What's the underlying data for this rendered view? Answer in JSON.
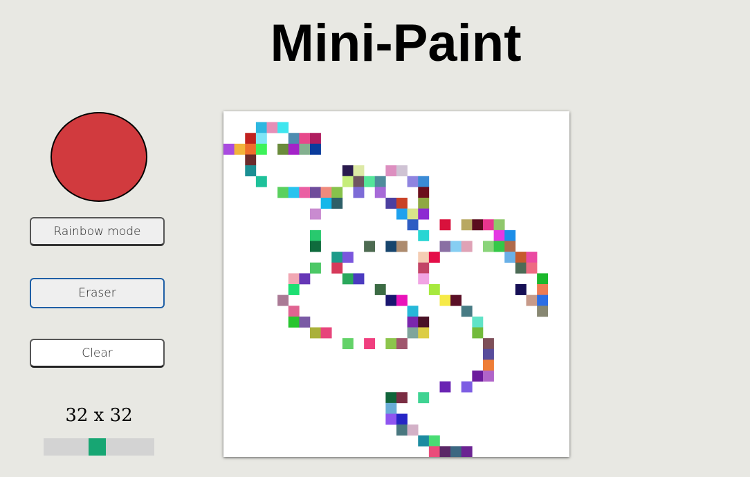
{
  "app": {
    "title": "Mini-Paint"
  },
  "controls": {
    "current_color": "#d13a3e",
    "rainbow_label": "Rainbow mode",
    "eraser_label": "Eraser",
    "clear_label": "Clear",
    "grid_size_label": "32 x 32",
    "grid_size": 32,
    "slider_min": 8,
    "slider_max": 64,
    "slider_fraction": 0.48
  },
  "canvas": {
    "grid_size": 32,
    "background": "#ffffff",
    "cells": [
      [
        3,
        1,
        "#2db7e0"
      ],
      [
        4,
        1,
        "#e58fb7"
      ],
      [
        5,
        1,
        "#3ee6ef"
      ],
      [
        2,
        2,
        "#c0211f"
      ],
      [
        3,
        2,
        "#80e5f6"
      ],
      [
        6,
        2,
        "#4e8cb0"
      ],
      [
        7,
        2,
        "#e7488b"
      ],
      [
        8,
        2,
        "#b01d5f"
      ],
      [
        0,
        3,
        "#a94be0"
      ],
      [
        1,
        3,
        "#f2b43b"
      ],
      [
        2,
        3,
        "#ef6f2b"
      ],
      [
        3,
        3,
        "#3df25a"
      ],
      [
        5,
        3,
        "#6a8b3b"
      ],
      [
        6,
        3,
        "#a423c8"
      ],
      [
        7,
        3,
        "#83b08f"
      ],
      [
        8,
        3,
        "#0b3c9c"
      ],
      [
        2,
        4,
        "#6b2b2c"
      ],
      [
        2,
        5,
        "#1b8f93"
      ],
      [
        11,
        5,
        "#2a1a4e"
      ],
      [
        12,
        5,
        "#dde9a6"
      ],
      [
        15,
        5,
        "#dd8fc0"
      ],
      [
        16,
        5,
        "#cfc3d4"
      ],
      [
        3,
        6,
        "#1ec19a"
      ],
      [
        11,
        6,
        "#c6ed7b"
      ],
      [
        12,
        6,
        "#6f5560"
      ],
      [
        13,
        6,
        "#55e59a"
      ],
      [
        14,
        6,
        "#4f8c9b"
      ],
      [
        17,
        6,
        "#8f84e0"
      ],
      [
        18,
        6,
        "#3b8bd6"
      ],
      [
        5,
        7,
        "#5ad05e"
      ],
      [
        6,
        7,
        "#29c3ee"
      ],
      [
        7,
        7,
        "#ea5fa3"
      ],
      [
        8,
        7,
        "#6f4c9b"
      ],
      [
        9,
        7,
        "#ef8a7d"
      ],
      [
        10,
        7,
        "#87c24b"
      ],
      [
        12,
        7,
        "#7d6bd7"
      ],
      [
        14,
        7,
        "#a76ad8"
      ],
      [
        18,
        7,
        "#6b0e1c"
      ],
      [
        9,
        8,
        "#13b7ea"
      ],
      [
        10,
        8,
        "#2e5f68"
      ],
      [
        15,
        8,
        "#4c3fa0"
      ],
      [
        16,
        8,
        "#c94227"
      ],
      [
        18,
        8,
        "#8fa843"
      ],
      [
        8,
        9,
        "#c98bd0"
      ],
      [
        16,
        9,
        "#1da1ee"
      ],
      [
        17,
        9,
        "#d9e48a"
      ],
      [
        18,
        9,
        "#8d2ad2"
      ],
      [
        17,
        10,
        "#2d5cc3"
      ],
      [
        20,
        10,
        "#d9113c"
      ],
      [
        22,
        10,
        "#b8a862"
      ],
      [
        23,
        10,
        "#5a0c1f"
      ],
      [
        24,
        10,
        "#e7368f"
      ],
      [
        25,
        10,
        "#8fc76b"
      ],
      [
        8,
        11,
        "#28c96e"
      ],
      [
        18,
        11,
        "#29d6d3"
      ],
      [
        25,
        11,
        "#e438e3"
      ],
      [
        26,
        11,
        "#1c8ee8"
      ],
      [
        8,
        12,
        "#0f6b3d"
      ],
      [
        13,
        12,
        "#4d6b51"
      ],
      [
        15,
        12,
        "#17456d"
      ],
      [
        16,
        12,
        "#ad8b6e"
      ],
      [
        20,
        12,
        "#8a6fa3"
      ],
      [
        21,
        12,
        "#86cef2"
      ],
      [
        22,
        12,
        "#dfa2b6"
      ],
      [
        24,
        12,
        "#8ad47a"
      ],
      [
        25,
        12,
        "#34c847"
      ],
      [
        26,
        12,
        "#b06a4b"
      ],
      [
        10,
        13,
        "#1c9b8a"
      ],
      [
        11,
        13,
        "#7a56dd"
      ],
      [
        18,
        13,
        "#f5cdb4"
      ],
      [
        19,
        13,
        "#e40d48"
      ],
      [
        26,
        13,
        "#69b0e7"
      ],
      [
        27,
        13,
        "#c65a2c"
      ],
      [
        28,
        13,
        "#ea4aa2"
      ],
      [
        8,
        14,
        "#4cc866"
      ],
      [
        10,
        14,
        "#d63a5b"
      ],
      [
        18,
        14,
        "#c34466"
      ],
      [
        27,
        14,
        "#4d6b56"
      ],
      [
        28,
        14,
        "#ee6b82"
      ],
      [
        6,
        15,
        "#f1a7b3"
      ],
      [
        7,
        15,
        "#6637b6"
      ],
      [
        11,
        15,
        "#2aa85b"
      ],
      [
        12,
        15,
        "#4b3bc0"
      ],
      [
        18,
        15,
        "#f1a4e3"
      ],
      [
        29,
        15,
        "#1bb82c"
      ],
      [
        6,
        16,
        "#1ddf72"
      ],
      [
        14,
        16,
        "#3c6b44"
      ],
      [
        19,
        16,
        "#a7e93d"
      ],
      [
        27,
        16,
        "#160f55"
      ],
      [
        29,
        16,
        "#ef7b54"
      ],
      [
        5,
        17,
        "#aa7a95"
      ],
      [
        15,
        17,
        "#1a1670"
      ],
      [
        16,
        17,
        "#e913ba"
      ],
      [
        20,
        17,
        "#f6ea47"
      ],
      [
        21,
        17,
        "#5a0f26"
      ],
      [
        28,
        17,
        "#c79a89"
      ],
      [
        29,
        17,
        "#2b6ee7"
      ],
      [
        6,
        18,
        "#e06391"
      ],
      [
        17,
        18,
        "#26b8d9"
      ],
      [
        22,
        18,
        "#477b84"
      ],
      [
        29,
        18,
        "#878772"
      ],
      [
        6,
        19,
        "#27c52f"
      ],
      [
        7,
        19,
        "#7a5aa5"
      ],
      [
        17,
        19,
        "#7a26ad"
      ],
      [
        18,
        19,
        "#4a1226"
      ],
      [
        23,
        19,
        "#60e3c7"
      ],
      [
        8,
        20,
        "#aab03a"
      ],
      [
        9,
        20,
        "#e7457b"
      ],
      [
        17,
        20,
        "#7fa59b"
      ],
      [
        18,
        20,
        "#dccd44"
      ],
      [
        23,
        20,
        "#73bb3b"
      ],
      [
        11,
        21,
        "#63d268"
      ],
      [
        13,
        21,
        "#f03f7f"
      ],
      [
        15,
        21,
        "#8cc54c"
      ],
      [
        16,
        21,
        "#a0566d"
      ],
      [
        24,
        21,
        "#7e4f59"
      ],
      [
        24,
        22,
        "#584c9b"
      ],
      [
        24,
        23,
        "#ee7d36"
      ],
      [
        23,
        24,
        "#6c1b9d"
      ],
      [
        24,
        24,
        "#b064c9"
      ],
      [
        20,
        25,
        "#6a24b3"
      ],
      [
        22,
        25,
        "#7d5de3"
      ],
      [
        15,
        26,
        "#11653a"
      ],
      [
        16,
        26,
        "#7a2d43"
      ],
      [
        18,
        26,
        "#3fd392"
      ],
      [
        15,
        27,
        "#69acd6"
      ],
      [
        15,
        28,
        "#8f55f0"
      ],
      [
        16,
        28,
        "#2625c6"
      ],
      [
        16,
        29,
        "#49777f"
      ],
      [
        17,
        29,
        "#d3b1c7"
      ],
      [
        18,
        30,
        "#1c8ba0"
      ],
      [
        19,
        30,
        "#49dc73"
      ],
      [
        19,
        31,
        "#ea4c7a"
      ],
      [
        20,
        31,
        "#5a2766"
      ],
      [
        21,
        31,
        "#3c6781"
      ],
      [
        22,
        31,
        "#6b2392"
      ]
    ]
  }
}
